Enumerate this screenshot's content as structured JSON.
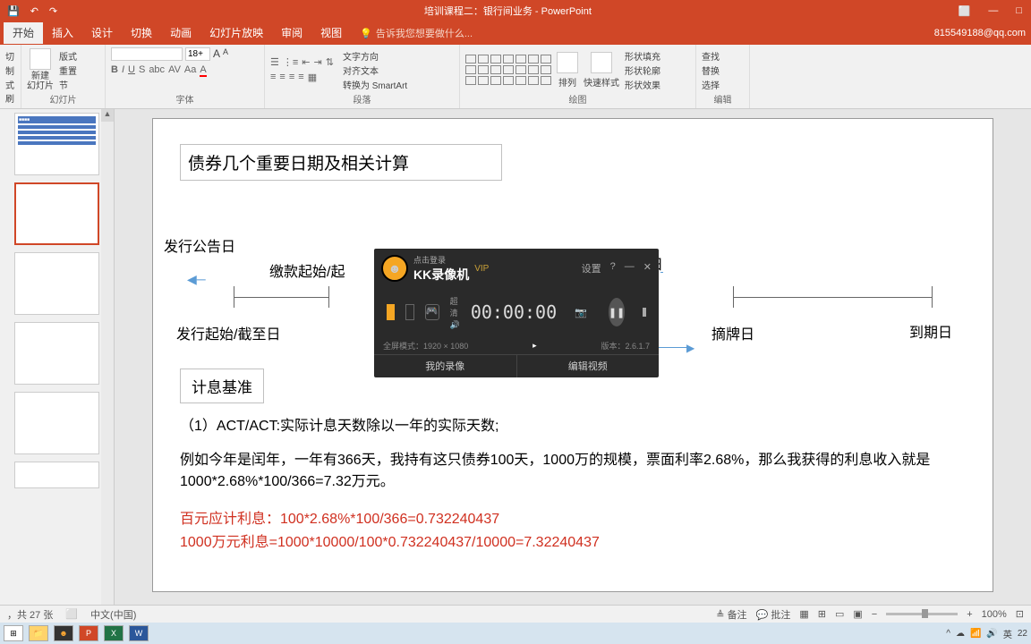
{
  "title_bar": {
    "doc_title": "培训课程二：银行间业务 - PowerPoint",
    "win_minimize": "—",
    "win_restore": "□"
  },
  "ribbon_tabs": {
    "tabs": [
      "开始",
      "插入",
      "设计",
      "切换",
      "动画",
      "幻灯片放映",
      "审阅",
      "视图"
    ],
    "tellme_icon": "💡",
    "tellme": "告诉我您想要做什么...",
    "email": "815549188@qq.com"
  },
  "ribbon": {
    "clipboard": {
      "cut": "切",
      "copy": "制",
      "format": "式刷",
      "label": ""
    },
    "slides": {
      "new": "新建\n幻灯片",
      "layout": "版式",
      "reset": "重置",
      "section": "节",
      "label": "幻灯片"
    },
    "font": {
      "size": "18+",
      "label": "字体",
      "b": "B",
      "i": "I",
      "u": "U",
      "s": "S"
    },
    "para": {
      "label": "段落",
      "dir": "文字方向",
      "align": "对齐文本",
      "smart": "转换为 SmartArt"
    },
    "draw": {
      "label": "绘图",
      "arrange": "排列",
      "quick": "快速样式",
      "fill": "形状填充",
      "outline": "形状轮廓",
      "effect": "形状效果"
    },
    "edit": {
      "find": "查找",
      "replace": "替换",
      "select": "选择",
      "label": "编辑"
    }
  },
  "slide": {
    "title": "债券几个重要日期及相关计算",
    "labels": {
      "announce": "发行公告日",
      "payment": "缴款起始/起",
      "exercise": "行权日",
      "issue": "发行起始/截至日",
      "delist": "摘牌日",
      "maturity": "到期日"
    },
    "sub_title": "计息基准",
    "body1": "（1）ACT/ACT:实际计息天数除以一年的实际天数;",
    "body2": "例如今年是闰年，一年有366天，我持有这只债券100天，1000万的规模，票面利率2.68%，那么我获得的利息收入就是1000*2.68%*100/366=7.32万元。",
    "red1": "百元应计利息：100*2.68%*100/366=0.732240437",
    "red2": "1000万元利息=1000*10000/100*0.732240437/10000=7.32240437"
  },
  "recorder": {
    "login": "点击登录",
    "brand": "KK录像机",
    "vip": "VIP",
    "settings": "设置",
    "help": "?",
    "min": "—",
    "close": "✕",
    "quality": "超清",
    "timer": "00:00:00",
    "info_left": "全屏模式：1920 × 1080",
    "info_right": "版本：2.6.1.7",
    "my": "我的录像",
    "edit": "编辑视频"
  },
  "status": {
    "page": "，共 27 张",
    "spell": "⬜",
    "lang": "中文(中国)",
    "notes": "备注",
    "comments": "批注",
    "zoom": "100%"
  },
  "taskbar": {
    "tray": [
      "^",
      "☁",
      "📶",
      "🔊",
      "英",
      "22"
    ]
  }
}
